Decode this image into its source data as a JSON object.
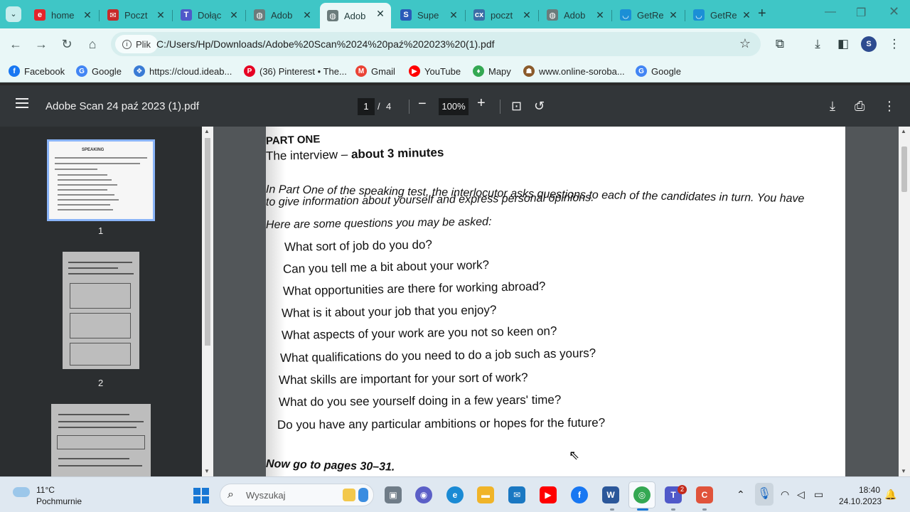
{
  "browser": {
    "tabs": [
      {
        "label": "home",
        "icon": "e-icon",
        "color": "#e5242b",
        "glyph": "e"
      },
      {
        "label": "Poczt",
        "icon": "mail-icon",
        "color": "#c72a2a",
        "glyph": "✉"
      },
      {
        "label": "Dołąc",
        "icon": "teams-icon",
        "color": "#5059c9",
        "glyph": "T"
      },
      {
        "label": "Adob",
        "icon": "globe-icon",
        "color": "#6b7b7b",
        "glyph": "◍"
      },
      {
        "label": "Adob",
        "icon": "globe-icon",
        "color": "#6b7b7b",
        "glyph": "◍",
        "active": true
      },
      {
        "label": "Supe",
        "icon": "s-logo-icon",
        "color": "#2a5ab8",
        "glyph": "S"
      },
      {
        "label": "poczt",
        "icon": "cx-icon",
        "color": "#3b6da6",
        "glyph": "cx"
      },
      {
        "label": "Adob",
        "icon": "globe-icon",
        "color": "#6b7b7b",
        "glyph": "◍"
      },
      {
        "label": "GetRe",
        "icon": "wave-icon",
        "color": "#1b8fd6",
        "glyph": "◡"
      },
      {
        "label": "GetRe",
        "icon": "wave-icon",
        "color": "#1b8fd6",
        "glyph": "◡"
      }
    ],
    "site_chip": "Plik",
    "url": "C:/Users/Hp/Downloads/Adobe%20Scan%2024%20paź%202023%20(1).pdf",
    "bookmarks": [
      {
        "label": "Facebook",
        "color": "#1877f2",
        "glyph": "f"
      },
      {
        "label": "Google",
        "color": "#4285f4",
        "glyph": "G"
      },
      {
        "label": "https://cloud.ideab...",
        "color": "#3a7bd5",
        "glyph": "❖"
      },
      {
        "label": "(36) Pinterest • The...",
        "color": "#e60023",
        "glyph": "P"
      },
      {
        "label": "Gmail",
        "color": "#ea4335",
        "glyph": "M"
      },
      {
        "label": "YouTube",
        "color": "#ff0000",
        "glyph": "▶"
      },
      {
        "label": "Mapy",
        "color": "#34a853",
        "glyph": "♦"
      },
      {
        "label": "www.online-soroba...",
        "color": "#8b5a2b",
        "glyph": "☗"
      },
      {
        "label": "Google",
        "color": "#4285f4",
        "glyph": "G"
      }
    ]
  },
  "pdf": {
    "title": "Adobe Scan 24 paź 2023 (1).pdf",
    "page_current": "1",
    "page_sep": "/",
    "page_total": "4",
    "zoom": "100%",
    "thumbnails": [
      {
        "label": "1",
        "heading": "SPEAKING"
      },
      {
        "label": "2",
        "heading": ""
      },
      {
        "label": "",
        "heading": ""
      }
    ],
    "content": {
      "part": "PART ONE",
      "heading_a": "The interview – ",
      "heading_b": "about 3 minutes",
      "intro_1": "In Part One of the speaking test, the interlocutor asks questions to each of the candidates in turn. You have",
      "intro_2": "to give information about yourself and express personal opinions.",
      "lead": "Here are some questions you may be asked:",
      "questions": [
        "What sort of job do you do?",
        "Can you tell me a bit about your work?",
        "What opportunities are there for working abroad?",
        "What is it about your job that you enjoy?",
        "What aspects of your work are you not so keen on?",
        "What qualifications do you need to do a job such as yours?",
        "What skills are important for your sort of work?",
        "What do you see yourself doing in a few years' time?",
        "Do you have any particular ambitions or hopes for the future?"
      ],
      "footer": "Now go to pages 30–31."
    }
  },
  "taskbar": {
    "weather_temp": "11°C",
    "weather_desc": "Pochmurnie",
    "search_placeholder": "Wyszukaj",
    "teams_badge": "2",
    "time": "18:40",
    "date": "24.10.2023"
  },
  "colors": {
    "tab_strip": "#3fc6c6",
    "toolbar": "#e9f7f7",
    "pdf_toolbar": "#323639",
    "pdf_bg": "#525659"
  }
}
